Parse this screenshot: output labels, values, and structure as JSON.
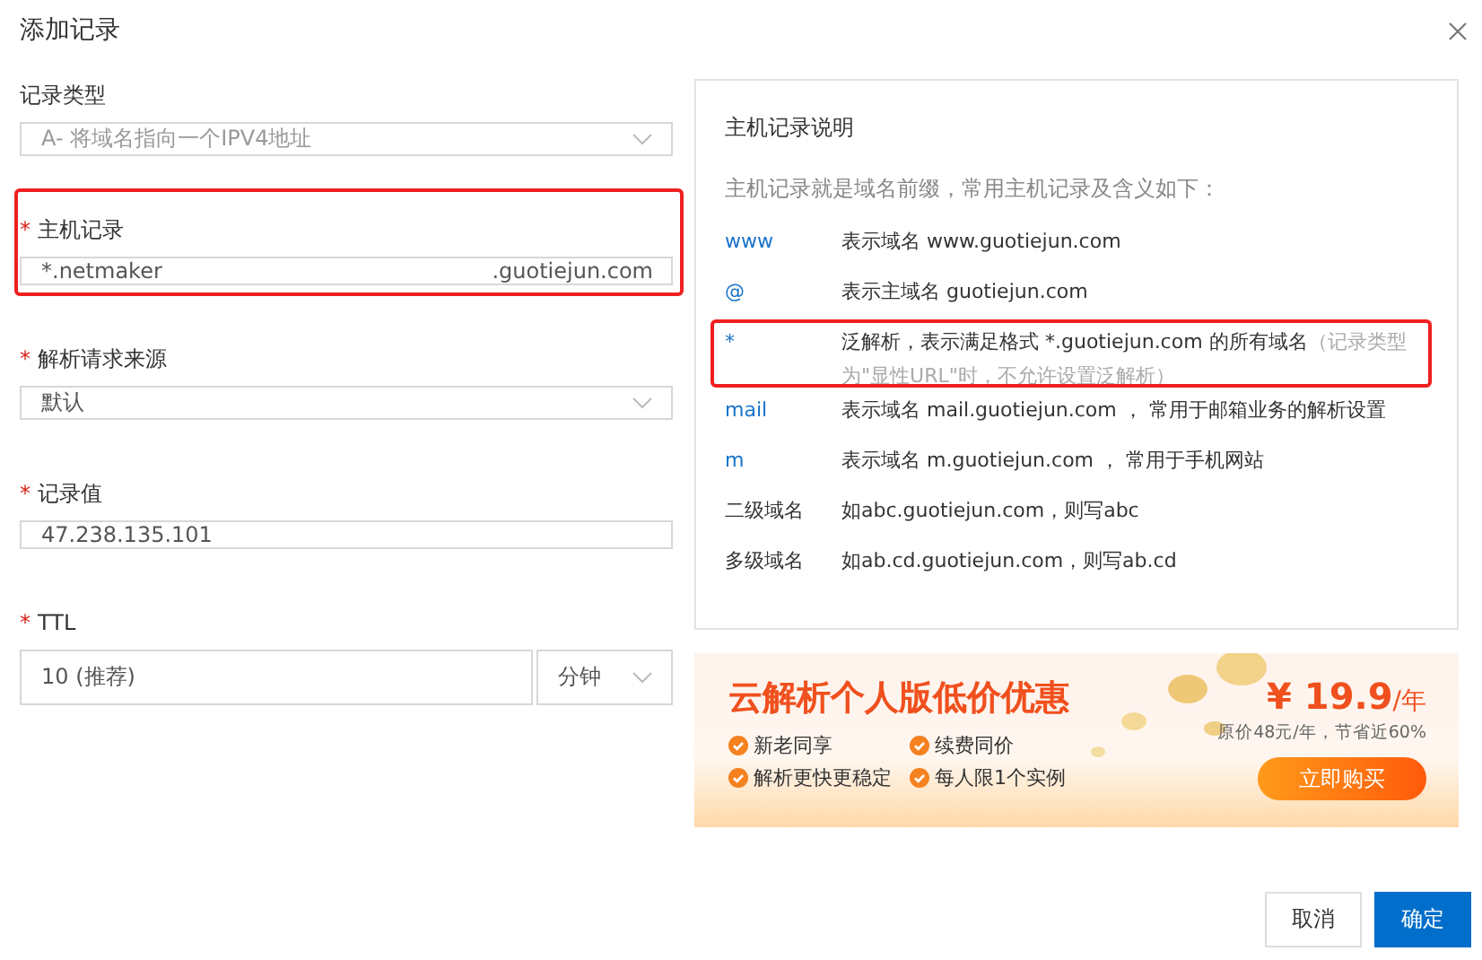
{
  "dialog": {
    "title": "添加记录"
  },
  "form": [
    {
      "kind": "select",
      "label": "记录类型",
      "required": false,
      "value": "A- 将域名指向一个IPV4地址",
      "disabled": true,
      "highlighted": false
    },
    {
      "kind": "suffix",
      "label": "主机记录",
      "required": true,
      "value": "*.netmaker",
      "suffix": ".guotiejun.com",
      "highlighted": true
    },
    {
      "kind": "select",
      "label": "解析请求来源",
      "required": true,
      "value": "默认",
      "disabled": false,
      "highlighted": false
    },
    {
      "kind": "input",
      "label": "记录值",
      "required": true,
      "value": "47.238.135.101",
      "highlighted": false
    },
    {
      "kind": "unit",
      "label": "TTL",
      "required": true,
      "value": "10 (推荐)",
      "unit": "分钟",
      "highlighted": false
    }
  ],
  "help": {
    "title": "主机记录说明",
    "intro": "主机记录就是域名前缀，常用主机记录及含义如下：",
    "rows": [
      {
        "key": "www",
        "link": true,
        "text": "表示域名 www.guotiejun.com",
        "highlighted": false
      },
      {
        "key": "@",
        "link": true,
        "text": "表示主域名 guotiejun.com",
        "highlighted": false
      },
      {
        "key": "*",
        "link": true,
        "text": "泛解析，表示满足格式 *.guotiejun.com 的所有域名",
        "note": "（记录类型为\"显性URL\"时，不允许设置泛解析）",
        "highlighted": true
      },
      {
        "key": "mail",
        "link": true,
        "text": "表示域名 mail.guotiejun.com ， 常用于邮箱业务的解析设置",
        "highlighted": false
      },
      {
        "key": "m",
        "link": true,
        "text": "表示域名 m.guotiejun.com ， 常用于手机网站",
        "highlighted": false
      },
      {
        "key": "二级域名",
        "link": false,
        "text": "如abc.guotiejun.com，则写abc",
        "highlighted": false
      },
      {
        "key": "多级域名",
        "link": false,
        "text": "如ab.cd.guotiejun.com，则写ab.cd",
        "highlighted": false
      }
    ]
  },
  "banner": {
    "headline": "云解析个人版低价优惠",
    "features": [
      "新老同享",
      "续费同价",
      "解析更快更稳定",
      "每人限1个实例"
    ],
    "price": "¥ 19.9",
    "per": "/年",
    "original": "原价48元/年，节省近60%",
    "cta": "立即购买"
  },
  "buttons": [
    {
      "label": "取消",
      "primary": false
    },
    {
      "label": "确定",
      "primary": true
    }
  ]
}
